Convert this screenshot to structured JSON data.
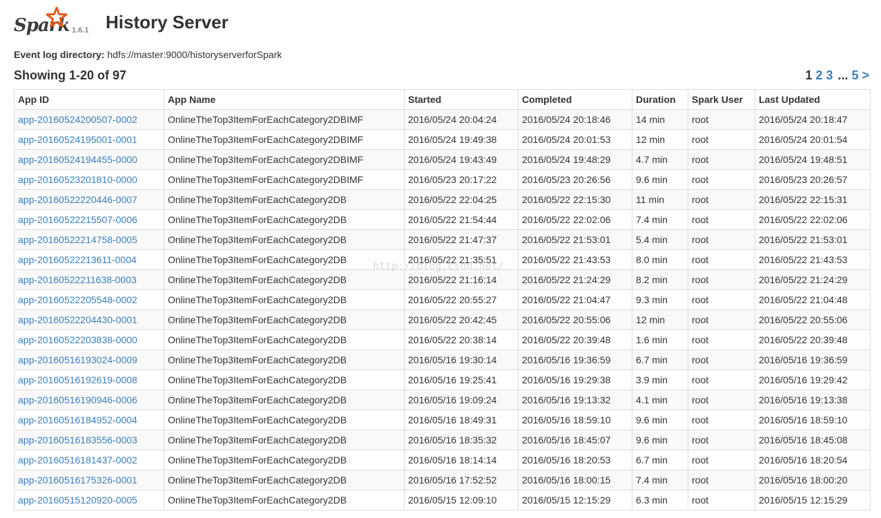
{
  "header": {
    "logo_text": "Spark",
    "version": "1.6.1",
    "title": "History Server"
  },
  "event_log": {
    "label": "Event log directory:",
    "value": "hdfs://master:9000/historyserverforSpark"
  },
  "showing": "Showing 1-20 of 97",
  "pager": {
    "current": "1",
    "page2": "2",
    "page3": "3",
    "ellipsis": "...",
    "last": "5",
    "next": ">"
  },
  "table": {
    "columns": [
      "App ID",
      "App Name",
      "Started",
      "Completed",
      "Duration",
      "Spark User",
      "Last Updated"
    ],
    "rows": [
      [
        "app-20160524200507-0002",
        "OnlineTheTop3ItemForEachCategory2DBIMF",
        "2016/05/24 20:04:24",
        "2016/05/24 20:18:46",
        "14 min",
        "root",
        "2016/05/24 20:18:47"
      ],
      [
        "app-20160524195001-0001",
        "OnlineTheTop3ItemForEachCategory2DBIMF",
        "2016/05/24 19:49:38",
        "2016/05/24 20:01:53",
        "12 min",
        "root",
        "2016/05/24 20:01:54"
      ],
      [
        "app-20160524194455-0000",
        "OnlineTheTop3ItemForEachCategory2DBIMF",
        "2016/05/24 19:43:49",
        "2016/05/24 19:48:29",
        "4.7 min",
        "root",
        "2016/05/24 19:48:51"
      ],
      [
        "app-20160523201810-0000",
        "OnlineTheTop3ItemForEachCategory2DBIMF",
        "2016/05/23 20:17:22",
        "2016/05/23 20:26:56",
        "9.6 min",
        "root",
        "2016/05/23 20:26:57"
      ],
      [
        "app-20160522220446-0007",
        "OnlineTheTop3ItemForEachCategory2DB",
        "2016/05/22 22:04:25",
        "2016/05/22 22:15:30",
        "11 min",
        "root",
        "2016/05/22 22:15:31"
      ],
      [
        "app-20160522215507-0006",
        "OnlineTheTop3ItemForEachCategory2DB",
        "2016/05/22 21:54:44",
        "2016/05/22 22:02:06",
        "7.4 min",
        "root",
        "2016/05/22 22:02:06"
      ],
      [
        "app-20160522214758-0005",
        "OnlineTheTop3ItemForEachCategory2DB",
        "2016/05/22 21:47:37",
        "2016/05/22 21:53:01",
        "5.4 min",
        "root",
        "2016/05/22 21:53:01"
      ],
      [
        "app-20160522213611-0004",
        "OnlineTheTop3ItemForEachCategory2DB",
        "2016/05/22 21:35:51",
        "2016/05/22 21:43:53",
        "8.0 min",
        "root",
        "2016/05/22 21:43:53"
      ],
      [
        "app-20160522211638-0003",
        "OnlineTheTop3ItemForEachCategory2DB",
        "2016/05/22 21:16:14",
        "2016/05/22 21:24:29",
        "8.2 min",
        "root",
        "2016/05/22 21:24:29"
      ],
      [
        "app-20160522205548-0002",
        "OnlineTheTop3ItemForEachCategory2DB",
        "2016/05/22 20:55:27",
        "2016/05/22 21:04:47",
        "9.3 min",
        "root",
        "2016/05/22 21:04:48"
      ],
      [
        "app-20160522204430-0001",
        "OnlineTheTop3ItemForEachCategory2DB",
        "2016/05/22 20:42:45",
        "2016/05/22 20:55:06",
        "12 min",
        "root",
        "2016/05/22 20:55:06"
      ],
      [
        "app-20160522203838-0000",
        "OnlineTheTop3ItemForEachCategory2DB",
        "2016/05/22 20:38:14",
        "2016/05/22 20:39:48",
        "1.6 min",
        "root",
        "2016/05/22 20:39:48"
      ],
      [
        "app-20160516193024-0009",
        "OnlineTheTop3ItemForEachCategory2DB",
        "2016/05/16 19:30:14",
        "2016/05/16 19:36:59",
        "6.7 min",
        "root",
        "2016/05/16 19:36:59"
      ],
      [
        "app-20160516192619-0008",
        "OnlineTheTop3ItemForEachCategory2DB",
        "2016/05/16 19:25:41",
        "2016/05/16 19:29:38",
        "3.9 min",
        "root",
        "2016/05/16 19:29:42"
      ],
      [
        "app-20160516190946-0006",
        "OnlineTheTop3ItemForEachCategory2DB",
        "2016/05/16 19:09:24",
        "2016/05/16 19:13:32",
        "4.1 min",
        "root",
        "2016/05/16 19:13:38"
      ],
      [
        "app-20160516184952-0004",
        "OnlineTheTop3ItemForEachCategory2DB",
        "2016/05/16 18:49:31",
        "2016/05/16 18:59:10",
        "9.6 min",
        "root",
        "2016/05/16 18:59:10"
      ],
      [
        "app-20160516183556-0003",
        "OnlineTheTop3ItemForEachCategory2DB",
        "2016/05/16 18:35:32",
        "2016/05/16 18:45:07",
        "9.6 min",
        "root",
        "2016/05/16 18:45:08"
      ],
      [
        "app-20160516181437-0002",
        "OnlineTheTop3ItemForEachCategory2DB",
        "2016/05/16 18:14:14",
        "2016/05/16 18:20:53",
        "6.7 min",
        "root",
        "2016/05/16 18:20:54"
      ],
      [
        "app-20160516175326-0001",
        "OnlineTheTop3ItemForEachCategory2DB",
        "2016/05/16 17:52:52",
        "2016/05/16 18:00:15",
        "7.4 min",
        "root",
        "2016/05/16 18:00:20"
      ],
      [
        "app-20160515120920-0005",
        "OnlineTheTop3ItemForEachCategory2DB",
        "2016/05/15 12:09:10",
        "2016/05/15 12:15:29",
        "6.3 min",
        "root",
        "2016/05/15 12:15:29"
      ]
    ]
  },
  "watermark": "http://blog.csdn.net/",
  "colors": {
    "link": "#3a7fbe",
    "logo_star": "#e25a1c",
    "border": "#dddddd"
  }
}
